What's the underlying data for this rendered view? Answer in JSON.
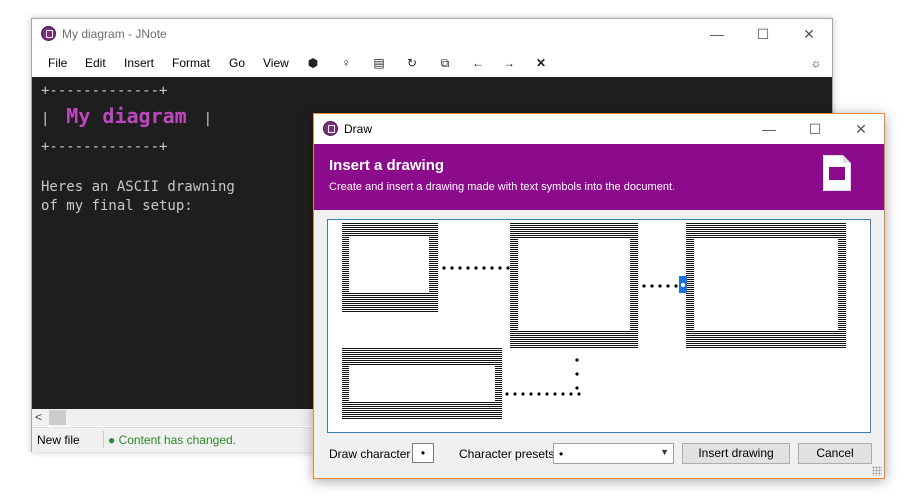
{
  "main_window": {
    "title": "My diagram - JNote",
    "controls": {
      "minimize": "—",
      "maximize": "☐",
      "close": "✕"
    },
    "menu": [
      "File",
      "Edit",
      "Insert",
      "Format",
      "Go",
      "View"
    ],
    "toolbar_icons": [
      "palette-icon",
      "pin-icon",
      "document-icon",
      "bucket-icon",
      "windows-icon",
      "arrow-left-icon",
      "arrow-right-icon",
      "close-icon"
    ],
    "toolbar_glyphs": [
      "⬢",
      "♀",
      "▤",
      "↻",
      "⧉",
      "←",
      "→",
      "✕"
    ],
    "settings_glyph": "☼",
    "editor": {
      "box_top": "+-------------+",
      "box_left": "|  ",
      "box_title": "My diagram",
      "box_right": "  |",
      "box_bottom": "+-------------+",
      "line1": "Heres an ASCII drawning",
      "line2": "of my final setup:"
    },
    "scroll_left": "<",
    "status": {
      "file": "New file",
      "message": "● Content has changed."
    }
  },
  "dialog": {
    "title": "Draw",
    "controls": {
      "minimize": "—",
      "maximize": "☐",
      "close": "✕"
    },
    "heading": "Insert a drawing",
    "subtitle": "Create and insert a drawing made with text symbols into the document.",
    "draw_character_label": "Draw character",
    "draw_character_value": "•",
    "presets_label": "Character presets",
    "presets_value": "•",
    "insert_button": "Insert drawing",
    "cancel_button": "Cancel"
  },
  "colors": {
    "accent": "#8c0a8c",
    "editor_bg": "#1e1e1e",
    "title_magenta": "#c047c0",
    "status_green": "#2a8a2a",
    "selection": "#1a73d8"
  }
}
